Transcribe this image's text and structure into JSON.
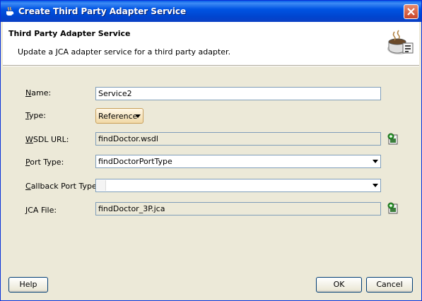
{
  "window": {
    "title": "Create Third Party Adapter Service"
  },
  "header": {
    "title": "Third Party Adapter Service",
    "subtitle": "Update a JCA adapter service for a third party adapter."
  },
  "form": {
    "name": {
      "label": "Name:",
      "value": "Service2"
    },
    "type": {
      "label": "Type:",
      "value": "Reference"
    },
    "wsdl_url": {
      "label": "WSDL URL:",
      "value": "findDoctor.wsdl"
    },
    "port_type": {
      "label": "Port Type:",
      "value": "findDoctorPortType"
    },
    "callback_port_type": {
      "label": "Callback Port Type:",
      "value": ""
    },
    "jca_file": {
      "label": "JCA File:",
      "value": "findDoctor_3P.jca"
    }
  },
  "buttons": {
    "help": "Help",
    "ok": "OK",
    "cancel": "Cancel"
  },
  "icons": {
    "title": "coffee-cup-icon",
    "header": "adapter-service-icon",
    "browse": "browse-file-icon",
    "close": "close-icon"
  },
  "colors": {
    "titlebar": "#0054e3",
    "dialog_bg": "#ece9d8",
    "close_button": "#c9452a"
  }
}
